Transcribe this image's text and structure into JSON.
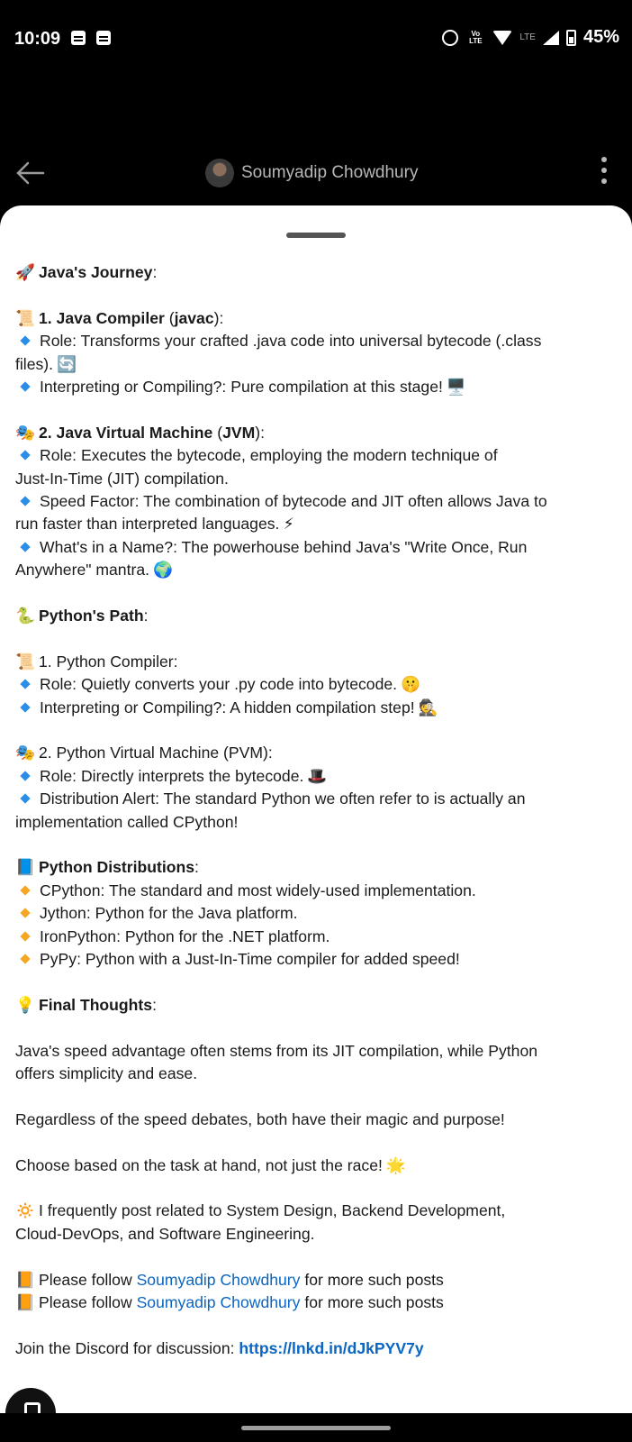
{
  "status_bar": {
    "time": "10:09",
    "volte": "Vo LTE",
    "lte": "LTE",
    "battery": "45%"
  },
  "app_bar": {
    "title": "Soumyadip Chowdhury"
  },
  "post": {
    "java_heading_emoji": "🚀",
    "java_heading": "Java's Journey",
    "java_compiler": {
      "emoji": "📜",
      "title_a": "1. Java Compiler",
      "title_b": "javac",
      "role_1": "Role: Transforms your crafted .java code into universal bytecode (.class",
      "role_2": "files).",
      "role_emoji": "🔄",
      "interp": "Interpreting or Compiling?: Pure compilation at this stage!",
      "interp_emoji": "🖥️"
    },
    "jvm": {
      "emoji": "🎭",
      "title_a": "2. Java Virtual Machine",
      "title_b": "JVM",
      "role_1": "Role: Executes the bytecode, employing the modern technique of",
      "role_2": "Just-In-Time (JIT) compilation.",
      "speed_1": "Speed Factor: The combination of bytecode and JIT often allows Java to",
      "speed_2": "run faster than interpreted languages.",
      "speed_emoji": "⚡",
      "name_1": "What's in a Name?: The powerhouse behind Java's \"Write Once, Run",
      "name_2": "Anywhere\" mantra.",
      "name_emoji": "🌍"
    },
    "python_heading_emoji": "🐍",
    "python_heading": "Python's Path",
    "py_compiler": {
      "emoji": "📜",
      "title": "1. Python Compiler:",
      "role": "Role: Quietly converts your .py code into bytecode.",
      "role_emoji": "🤫",
      "interp": "Interpreting or Compiling?: A hidden compilation step!",
      "interp_emoji": "🕵️"
    },
    "pvm": {
      "emoji": "🎭",
      "title": "2. Python Virtual Machine (PVM):",
      "role": "Role: Directly interprets the bytecode.",
      "role_emoji": "🎩",
      "dist_1": "Distribution Alert: The standard Python we often refer to is actually an",
      "dist_2": "implementation called CPython!"
    },
    "distributions": {
      "emoji": "📘",
      "heading": "Python Distributions",
      "items": [
        "CPython: The standard and most widely-used implementation.",
        "Jython: Python for the Java platform.",
        "IronPython: Python for the .NET platform.",
        "PyPy: Python with a Just-In-Time compiler for added speed!"
      ]
    },
    "final": {
      "emoji": "💡",
      "heading": "Final Thoughts",
      "p1_1": "Java's speed advantage often stems from its JIT compilation, while Python",
      "p1_2": "offers simplicity and ease.",
      "p2": "Regardless of the speed debates, both have their magic and purpose!",
      "p3": "Choose based on the task at hand, not just the race!",
      "p3_emoji": "🌟"
    },
    "footer": {
      "sun_emoji": "🔅",
      "about_1": "I frequently post related to System Design, Backend Development,",
      "about_2": "Cloud-DevOps, and Software Engineering.",
      "follow_emoji": "📙",
      "follow_pre": "Please follow",
      "follow_name": "Soumyadip Chowdhury",
      "follow_post": "for more such posts",
      "discord_pre": "Join the Discord for discussion:",
      "discord_link": "https://lnkd.in/dJkPYV7y"
    }
  },
  "colors": {
    "link": "#0a66c2",
    "bullet_blue": "#2b8ee6",
    "bullet_orange": "#f5a623"
  }
}
